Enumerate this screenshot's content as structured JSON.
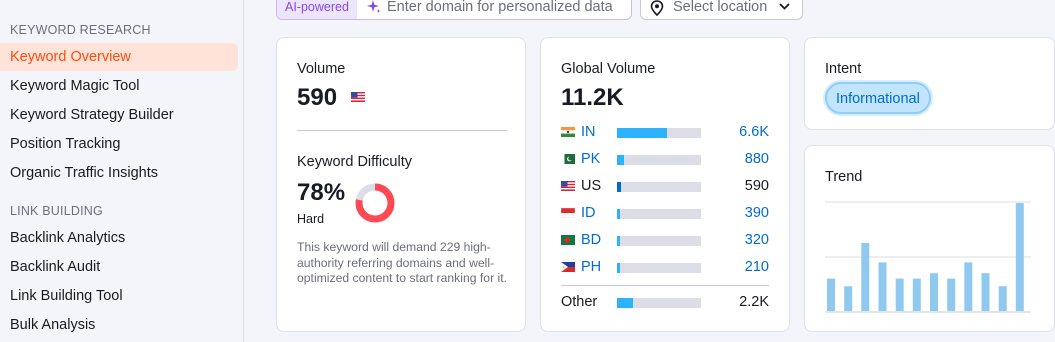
{
  "sidebar": {
    "section1_title": "KEYWORD RESEARCH",
    "section1_items": [
      "Keyword Overview",
      "Keyword Magic Tool",
      "Keyword Strategy Builder",
      "Position Tracking",
      "Organic Traffic Insights"
    ],
    "section2_title": "LINK BUILDING",
    "section2_items": [
      "Backlink Analytics",
      "Backlink Audit",
      "Link Building Tool",
      "Bulk Analysis"
    ]
  },
  "topbar": {
    "ai_tag": "AI-powered",
    "domain_placeholder": "Enter domain for personalized data",
    "location_label": "Select location"
  },
  "volume_card": {
    "label": "Volume",
    "value": "590",
    "kd_label": "Keyword Difficulty",
    "kd_value": "78%",
    "kd_level": "Hard",
    "kd_percent": 78,
    "kd_description": "This keyword will demand 229 high-authority referring domains and well-optimized content to start ranking for it."
  },
  "global_volume": {
    "label": "Global Volume",
    "value": "11.2K",
    "rows": [
      {
        "code": "IN",
        "value": "6.6K",
        "share": 0.59
      },
      {
        "code": "PK",
        "value": "880",
        "share": 0.08
      },
      {
        "code": "US",
        "value": "590",
        "share": 0.05
      },
      {
        "code": "ID",
        "value": "390",
        "share": 0.035
      },
      {
        "code": "BD",
        "value": "320",
        "share": 0.03
      },
      {
        "code": "PH",
        "value": "210",
        "share": 0.025
      }
    ],
    "other_label": "Other",
    "other_value": "2.2K",
    "other_share": 0.19
  },
  "intent": {
    "label": "Intent",
    "badge": "Informational"
  },
  "trend": {
    "label": "Trend",
    "values": [
      0.3,
      0.23,
      0.63,
      0.45,
      0.3,
      0.3,
      0.35,
      0.3,
      0.45,
      0.35,
      0.23,
      1.0
    ]
  },
  "colors": {
    "accent": "#ff4c0c",
    "link": "#006dca",
    "bar": "#2bb3ff",
    "trend_bar": "#90c9ef",
    "kd_red": "#ff4953"
  }
}
